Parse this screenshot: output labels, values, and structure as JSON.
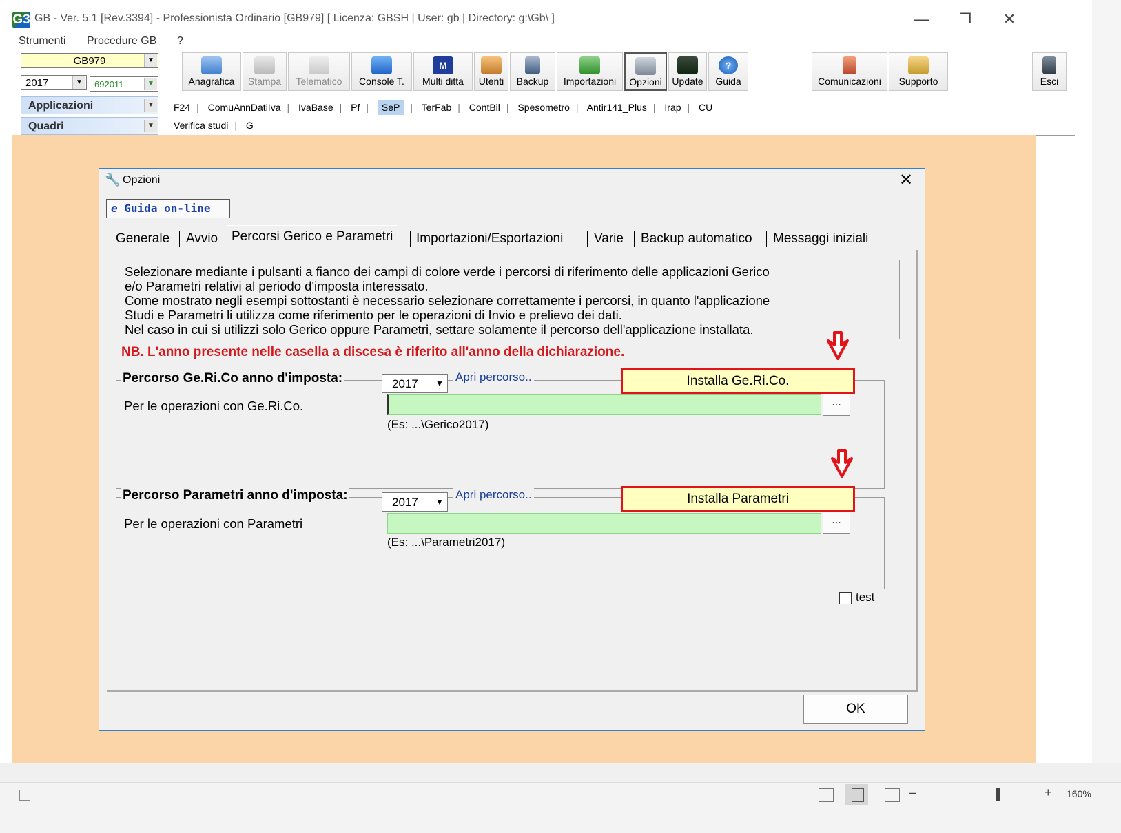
{
  "window": {
    "title": "GB - Ver. 5.1 [Rev.3394] -  Professionista Ordinario [GB979]      [ Licenza: GBSH | User: gb | Directory: g:\\Gb\\ ]",
    "logo": "G3"
  },
  "menu": {
    "items": [
      "Strumenti",
      "Procedure GB",
      "?"
    ]
  },
  "selectors": {
    "client": "GB979",
    "year": "2017",
    "code": "692011 -",
    "applicazioni": "Applicazioni",
    "quadri": "Quadri"
  },
  "toolbar": {
    "buttons": [
      {
        "label": "Anagrafica",
        "icon": "address-book-icon"
      },
      {
        "label": "Stampa",
        "icon": "printer-icon"
      },
      {
        "label": "Telematico",
        "icon": "telematico-icon"
      },
      {
        "label": "Console T.",
        "icon": "console-icon"
      },
      {
        "label": "Multi ditta",
        "icon": "multi-ditta-icon"
      },
      {
        "label": "Utenti",
        "icon": "users-icon"
      },
      {
        "label": "Backup",
        "icon": "backup-icon"
      },
      {
        "label": "Importazioni",
        "icon": "import-icon"
      },
      {
        "label": "Opzioni",
        "icon": "wrench-icon"
      },
      {
        "label": "Update",
        "icon": "update-icon"
      },
      {
        "label": "Guida",
        "icon": "help-icon"
      },
      {
        "label": "Comunicazioni",
        "icon": "comunicazioni-icon"
      },
      {
        "label": "Supporto",
        "icon": "support-icon"
      },
      {
        "label": "Esci",
        "icon": "exit-door-icon"
      }
    ]
  },
  "app_links": [
    "F24",
    "ComuAnnDatiIva",
    "IvaBase",
    "Pf",
    "SeP",
    "TerFab",
    "ContBil",
    "Spesometro",
    "Antir141_Plus",
    "Irap",
    "CU"
  ],
  "quadri_links": [
    "Verifica studi",
    "G"
  ],
  "dialog": {
    "title": "Opzioni",
    "help_button": "Guida on-line",
    "tabs": [
      "Generale",
      "Avvio",
      "Percorsi Gerico e Parametri",
      "Importazioni/Esportazioni",
      "Varie",
      "Backup automatico",
      "Messaggi iniziali"
    ],
    "info_lines": [
      "Selezionare mediante i pulsanti a fianco dei campi di colore verde i percorsi di riferimento delle applicazioni Gerico",
      "e/o Parametri relativi al periodo d'imposta interessato.",
      "Come mostrato negli esempi sottostanti è necessario selezionare correttamente i percorsi, in quanto l'applicazione",
      "Studi e Parametri li utilizza come riferimento per le operazioni di Invio e prelievo dei dati.",
      "Nel caso in cui si utilizzi solo Gerico oppure Parametri, settare solamente il percorso dell'applicazione installata."
    ],
    "nb": "NB. L'anno presente nelle casella a discesa è riferito all'anno della dichiarazione.",
    "gerico": {
      "group_title": "Percorso Ge.Ri.Co anno d'imposta:",
      "year": "2017",
      "open_link": "Apri percorso..",
      "install": "Installa Ge.Ri.Co.",
      "row_label": "Per le operazioni con Ge.Ri.Co.",
      "path": "",
      "browse": "...",
      "example": "(Es: ...\\Gerico2017)"
    },
    "parametri": {
      "group_title": "Percorso Parametri anno d'imposta:",
      "year": "2017",
      "open_link": "Apri percorso..",
      "install": "Installa Parametri",
      "row_label": "Per le operazioni con Parametri",
      "path": "",
      "browse": "...",
      "example": "(Es: ...\\Parametri2017)"
    },
    "test_label": "test",
    "ok": "OK"
  },
  "statusbar": {
    "zoom": "160%"
  },
  "colors": {
    "workspace": "#fbd4a8",
    "path_field": "#c7f7c0",
    "install_fill": "#ffffc0",
    "highlight_red": "#e2141a",
    "nb_text": "#d4181c"
  }
}
